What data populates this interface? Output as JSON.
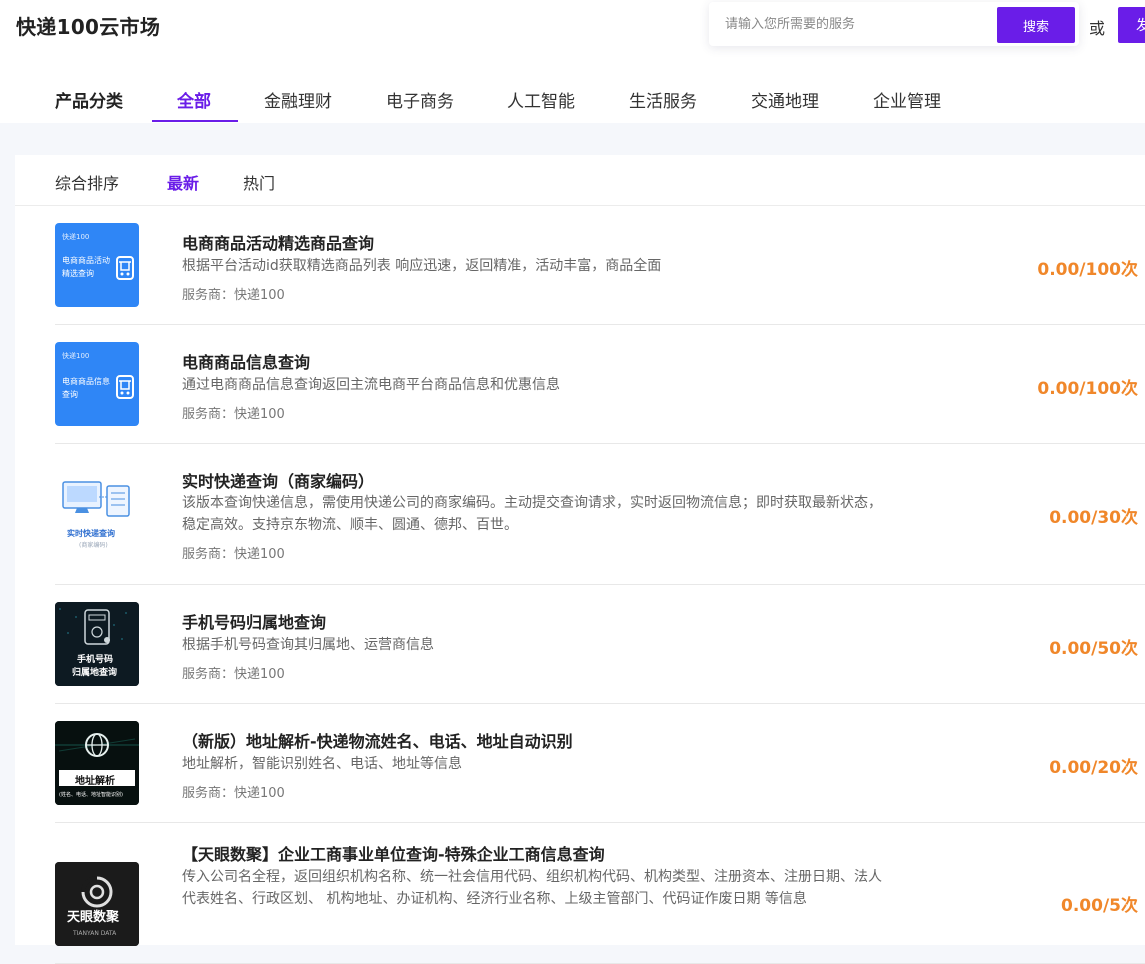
{
  "header": {
    "site_title": "快递100云市场",
    "search_placeholder": "请输入您所需要的服务",
    "search_button": "搜索",
    "or_text": "或",
    "publish_button": "发布需求"
  },
  "category_nav": {
    "label": "产品分类",
    "tabs": [
      {
        "label": "全部",
        "active": true
      },
      {
        "label": "金融理财",
        "active": false
      },
      {
        "label": "电子商务",
        "active": false
      },
      {
        "label": "人工智能",
        "active": false
      },
      {
        "label": "生活服务",
        "active": false
      },
      {
        "label": "交通地理",
        "active": false
      },
      {
        "label": "企业管理",
        "active": false
      }
    ]
  },
  "sort_bar": {
    "tabs": [
      {
        "label": "综合排序",
        "active": false
      },
      {
        "label": "最新",
        "active": true
      },
      {
        "label": "热门",
        "active": false
      }
    ]
  },
  "products": [
    {
      "title": "电商商品活动精选商品查询",
      "description": "根据平台活动id获取精选商品列表 响应迅速，返回精准，活动丰富，商品全面",
      "vendor": "服务商：快递100",
      "price": "0.00/100次",
      "thumb_brand": "快递100",
      "thumb_caption": [
        "电商商品活动",
        "精选查询"
      ]
    },
    {
      "title": "电商商品信息查询",
      "description": "通过电商商品信息查询返回主流电商平台商品信息和优惠信息",
      "vendor": "服务商：快递100",
      "price": "0.00/100次",
      "thumb_brand": "快递100",
      "thumb_caption": [
        "电商商品信息",
        "查询"
      ]
    },
    {
      "title": "实时快递查询（商家编码）",
      "description": "该版本查询快递信息，需使用快递公司的商家编码。主动提交查询请求，实时返回物流信息；即时获取最新状态，稳定高效。支持京东物流、顺丰、圆通、德邦、百世。",
      "vendor": "服务商：快递100",
      "price": "0.00/30次",
      "thumb_caption": [
        "实时快递查询",
        "(商家编码)"
      ]
    },
    {
      "title": "手机号码归属地查询",
      "description": "根据手机号码查询其归属地、运营商信息",
      "vendor": "服务商：快递100",
      "price": "0.00/50次",
      "thumb_caption": [
        "手机号码",
        "归属地查询"
      ]
    },
    {
      "title": "（新版）地址解析-快递物流姓名、电话、地址自动识别",
      "description": "地址解析，智能识别姓名、电话、地址等信息",
      "vendor": "服务商：快递100",
      "price": "0.00/20次",
      "thumb_caption": [
        "地址解析",
        "(姓名、电话、地址智能识别)"
      ]
    },
    {
      "title": "【天眼数聚】企业工商事业单位查询-特殊企业工商信息查询",
      "description": "传入公司名全程，返回组织机构名称、统一社会信用代码、组织机构代码、机构类型、注册资本、注册日期、法人代表姓名、行政区划、 机构地址、办证机构、经济行业名称、上级主管部门、代码证作废日期 等信息",
      "vendor": "服务商：快递100",
      "price": "0.00/5次",
      "thumb_caption": [
        "天眼数聚",
        "TIANYAN DATA"
      ]
    }
  ],
  "colors": {
    "accent": "#6a1de8",
    "price": "#f0872a",
    "thumb_blue": "#2f86f6"
  }
}
